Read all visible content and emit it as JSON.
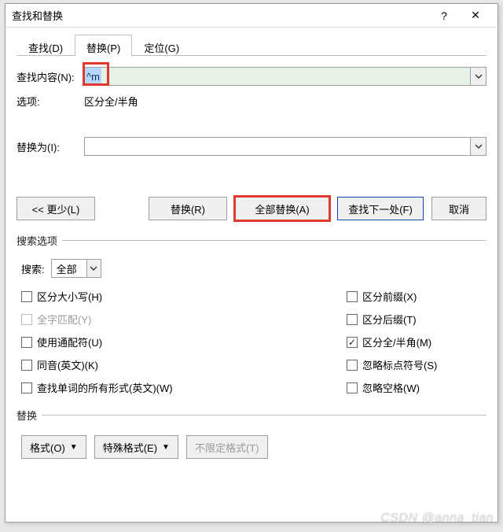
{
  "title": "查找和替换",
  "tabs": {
    "find": "查找(D)",
    "replace": "替换(P)",
    "goto": "定位(G)"
  },
  "findLabel": "查找内容(N):",
  "findValue": "^m",
  "optionsLabel": "选项:",
  "optionsValue": "区分全/半角",
  "replaceLabel": "替换为(I):",
  "replaceValue": "",
  "buttons": {
    "less": "<< 更少(L)",
    "replace": "替换(R)",
    "replaceAll": "全部替换(A)",
    "findNext": "查找下一处(F)",
    "cancel": "取消"
  },
  "searchOptionsLegend": "搜索选项",
  "searchLabel": "搜索:",
  "searchScope": "全部",
  "checkboxesLeft": [
    {
      "label": "区分大小写(H)",
      "checked": false,
      "disabled": false
    },
    {
      "label": "全字匹配(Y)",
      "checked": false,
      "disabled": true
    },
    {
      "label": "使用通配符(U)",
      "checked": false,
      "disabled": false
    },
    {
      "label": "同音(英文)(K)",
      "checked": false,
      "disabled": false
    },
    {
      "label": "查找单词的所有形式(英文)(W)",
      "checked": false,
      "disabled": false
    }
  ],
  "checkboxesRight": [
    {
      "label": "区分前缀(X)",
      "checked": false,
      "disabled": false
    },
    {
      "label": "区分后缀(T)",
      "checked": false,
      "disabled": false
    },
    {
      "label": "区分全/半角(M)",
      "checked": true,
      "disabled": false
    },
    {
      "label": "忽略标点符号(S)",
      "checked": false,
      "disabled": false
    },
    {
      "label": "忽略空格(W)",
      "checked": false,
      "disabled": false
    }
  ],
  "replaceLegend": "替换",
  "formatButtons": {
    "format": "格式(O)",
    "special": "特殊格式(E)",
    "noFormat": "不限定格式(T)"
  },
  "watermark": "CSDN @anna_tian"
}
